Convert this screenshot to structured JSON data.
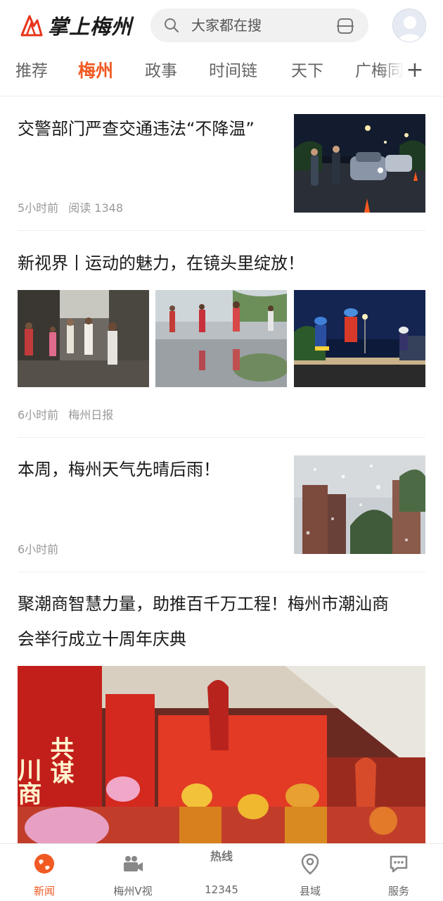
{
  "header": {
    "logo_text": "掌上梅州",
    "search_placeholder": "大家都在搜"
  },
  "tabs": [
    {
      "label": "推荐",
      "active": false
    },
    {
      "label": "梅州",
      "active": true
    },
    {
      "label": "政事",
      "active": false
    },
    {
      "label": "时间链",
      "active": false
    },
    {
      "label": "天下",
      "active": false
    },
    {
      "label": "广梅同",
      "active": false
    }
  ],
  "articles": [
    {
      "title": "交警部门严查交通违法“不降温”",
      "time": "5小时前",
      "reads": "阅读 1348"
    },
    {
      "title": "新视界丨运动的魅力，在镜头里绽放！",
      "time": "6小时前",
      "source": "梅州日报"
    },
    {
      "title": "本周，梅州天气先晴后雨！",
      "time": "6小时前"
    },
    {
      "title_line1": "聚潮商智慧力量，助推百千万工程！梅州市潮汕商",
      "title_line2": "会举行成立十周年庆典",
      "banner_left": "共谋发展",
      "banner_right": "川商会友"
    }
  ],
  "bottom_nav": [
    {
      "label": "新闻",
      "active": true,
      "icon": "globe-icon"
    },
    {
      "label": "梅州V视",
      "active": false,
      "icon": "video-camera-icon"
    },
    {
      "label": "12345",
      "active": false,
      "icon": "hotline-icon",
      "icon_text": "热线"
    },
    {
      "label": "县域",
      "active": false,
      "icon": "location-pin-icon"
    },
    {
      "label": "服务",
      "active": false,
      "icon": "chat-bubble-icon"
    }
  ],
  "colors": {
    "accent": "#f05a22",
    "text": "#1a1a1a",
    "meta": "#999999"
  }
}
